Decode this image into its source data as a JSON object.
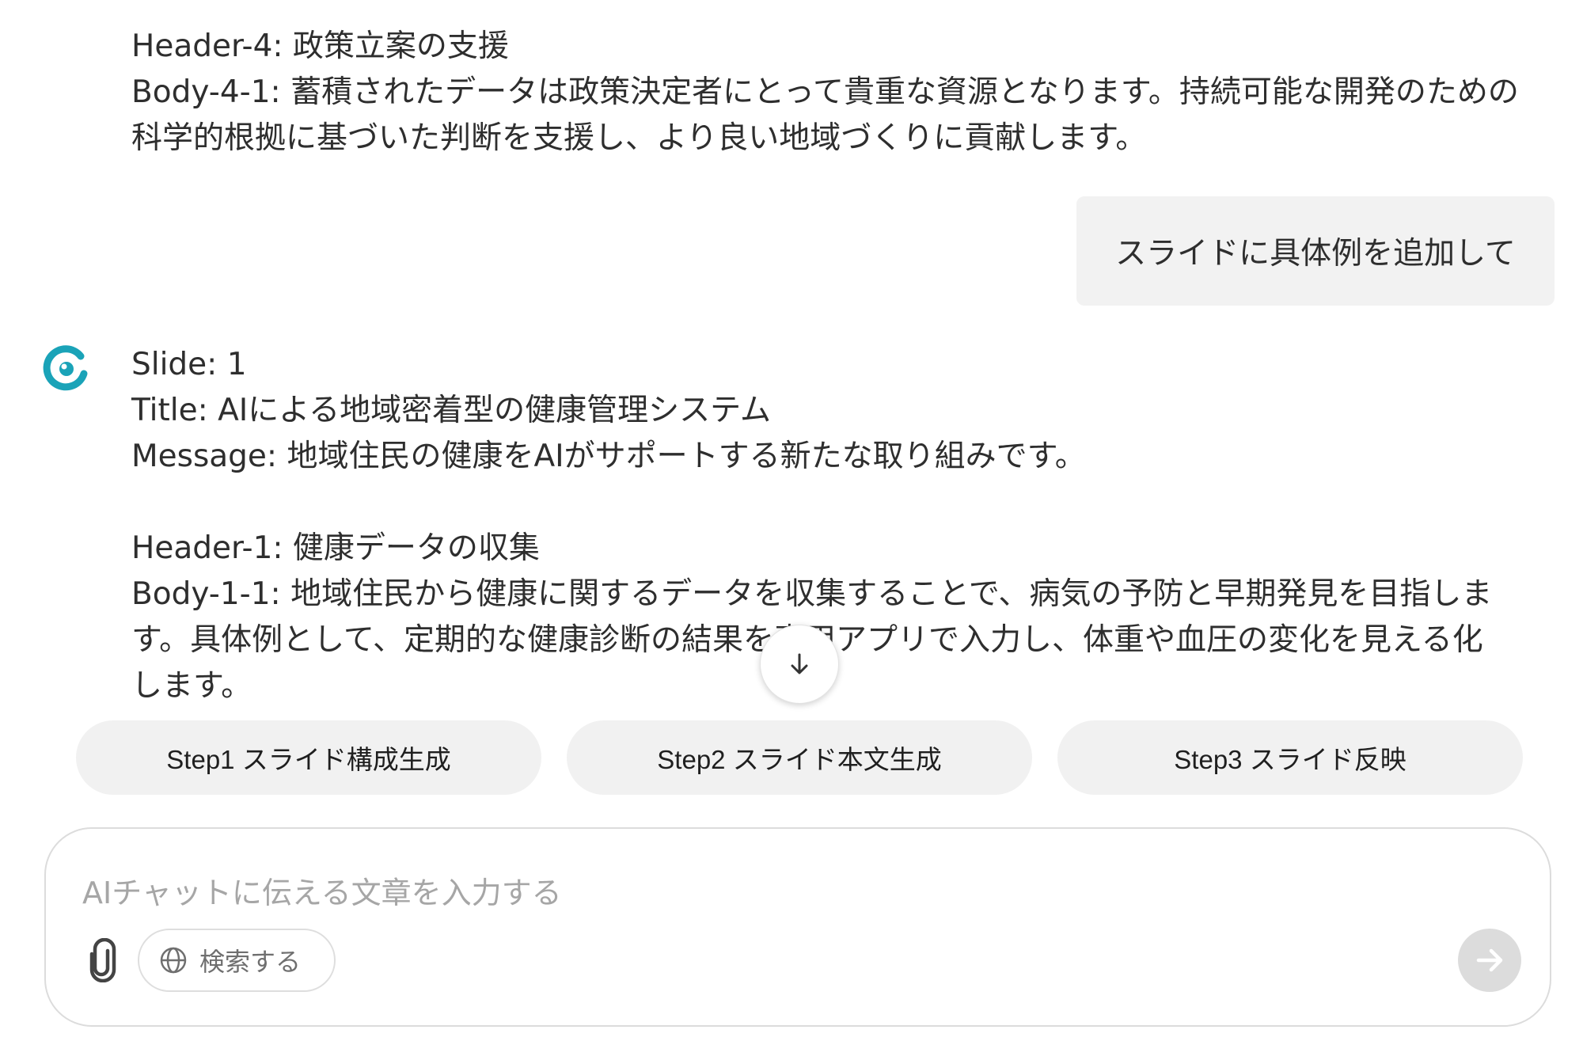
{
  "previous_message": {
    "header4": "Header-4: 政策立案の支援",
    "body41_line1": "Body-4-1: 蓄積されたデータは政策決定者にとって貴重な資源となります。持続可能な開発のための",
    "body41_line2": "科学的根拠に基づいた判断を支援し、より良い地域づくりに貢献します。"
  },
  "user_message": {
    "text": "スライドに具体例を追加して"
  },
  "ai_message": {
    "slide": "Slide: 1",
    "title": "Title: AIによる地域密着型の健康管理システム",
    "message": "Message: 地域住民の健康をAIがサポートする新たな取り組みです。",
    "header1": "Header-1: 健康データの収集",
    "body11_line1": "Body-1-1: 地域住民から健康に関するデータを収集することで、病気の予防と早期発見を目指しま",
    "body11_line2": "す。具体例として、定期的な健康診断の結果を専用アプリで入力し、体重や血圧の変化を見える化",
    "body11_line3": "します。"
  },
  "steps": [
    {
      "label": "Step1 スライド構成生成"
    },
    {
      "label": "Step2 スライド本文生成"
    },
    {
      "label": "Step3 スライド反映"
    }
  ],
  "composer": {
    "placeholder": "AIチャットに伝える文章を入力する",
    "search_label": "検索する"
  },
  "icons": {
    "scroll": "arrow-down-icon",
    "attach": "paperclip-icon",
    "search": "globe-icon",
    "send": "arrow-right-icon",
    "logo": "assistant-logo-icon"
  },
  "colors": {
    "logo_primary": "#1aa3b8",
    "send_bg": "#dcdcdc",
    "bubble_bg": "#f2f2f2",
    "chip_bg": "#f1f1f1"
  }
}
